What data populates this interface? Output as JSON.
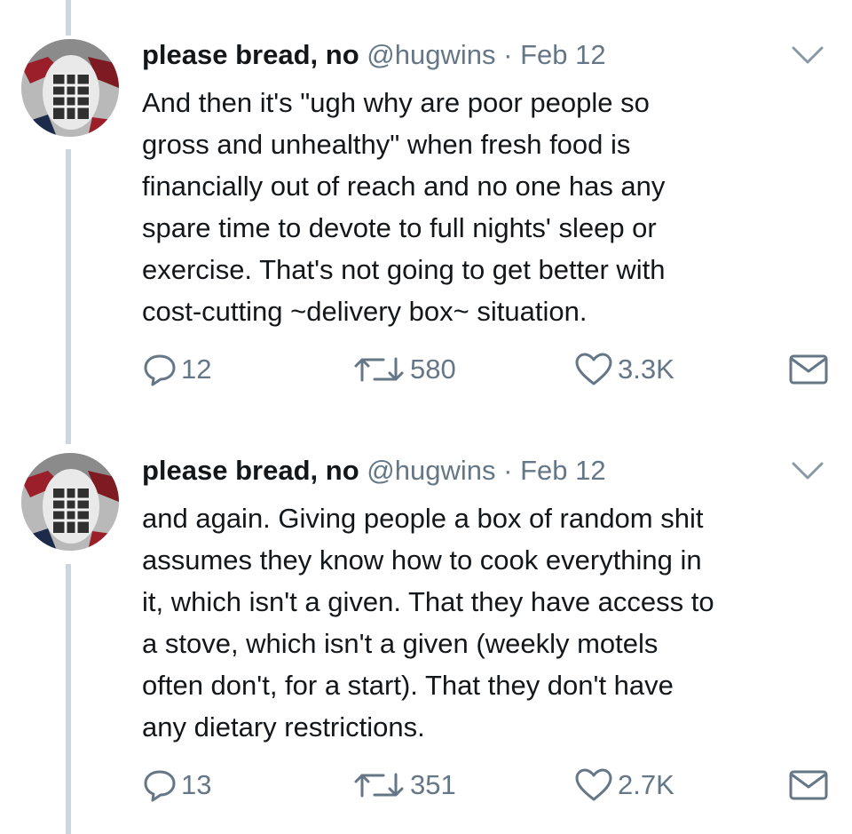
{
  "tweets": [
    {
      "author_name": "please bread, no",
      "handle": "@hugwins",
      "separator": "·",
      "date": "Feb 12",
      "avatar_icon": "goalie-mask-avatar-icon",
      "text_lines": [
        "And then it's \"ugh why are poor people so",
        "gross and unhealthy\" when fresh food is",
        "financially out of reach and no one has any",
        "spare time to devote to full nights' sleep or",
        "exercise. That's not going to get better with",
        "cost-cutting ~delivery box~ situation."
      ],
      "replies": "12",
      "retweets": "580",
      "likes": "3.3K"
    },
    {
      "author_name": "please bread, no",
      "handle": "@hugwins",
      "separator": "·",
      "date": "Feb 12",
      "avatar_icon": "goalie-mask-avatar-icon",
      "text_lines": [
        "and again. Giving people a box of random shit",
        "assumes they know how to cook everything in",
        "it, which isn't a given. That they have access to",
        "a stove, which isn't a given (weekly motels",
        "often don't, for a start). That they don't have",
        "any dietary restrictions."
      ],
      "replies": "13",
      "retweets": "351",
      "likes": "2.7K"
    }
  ],
  "icons": {
    "reply": "reply-icon",
    "retweet": "retweet-icon",
    "like": "heart-icon",
    "dm": "envelope-icon",
    "menu": "chevron-down-icon"
  },
  "colors": {
    "text": "#14171a",
    "muted": "#657786",
    "thread_line": "#ccd6dd"
  }
}
